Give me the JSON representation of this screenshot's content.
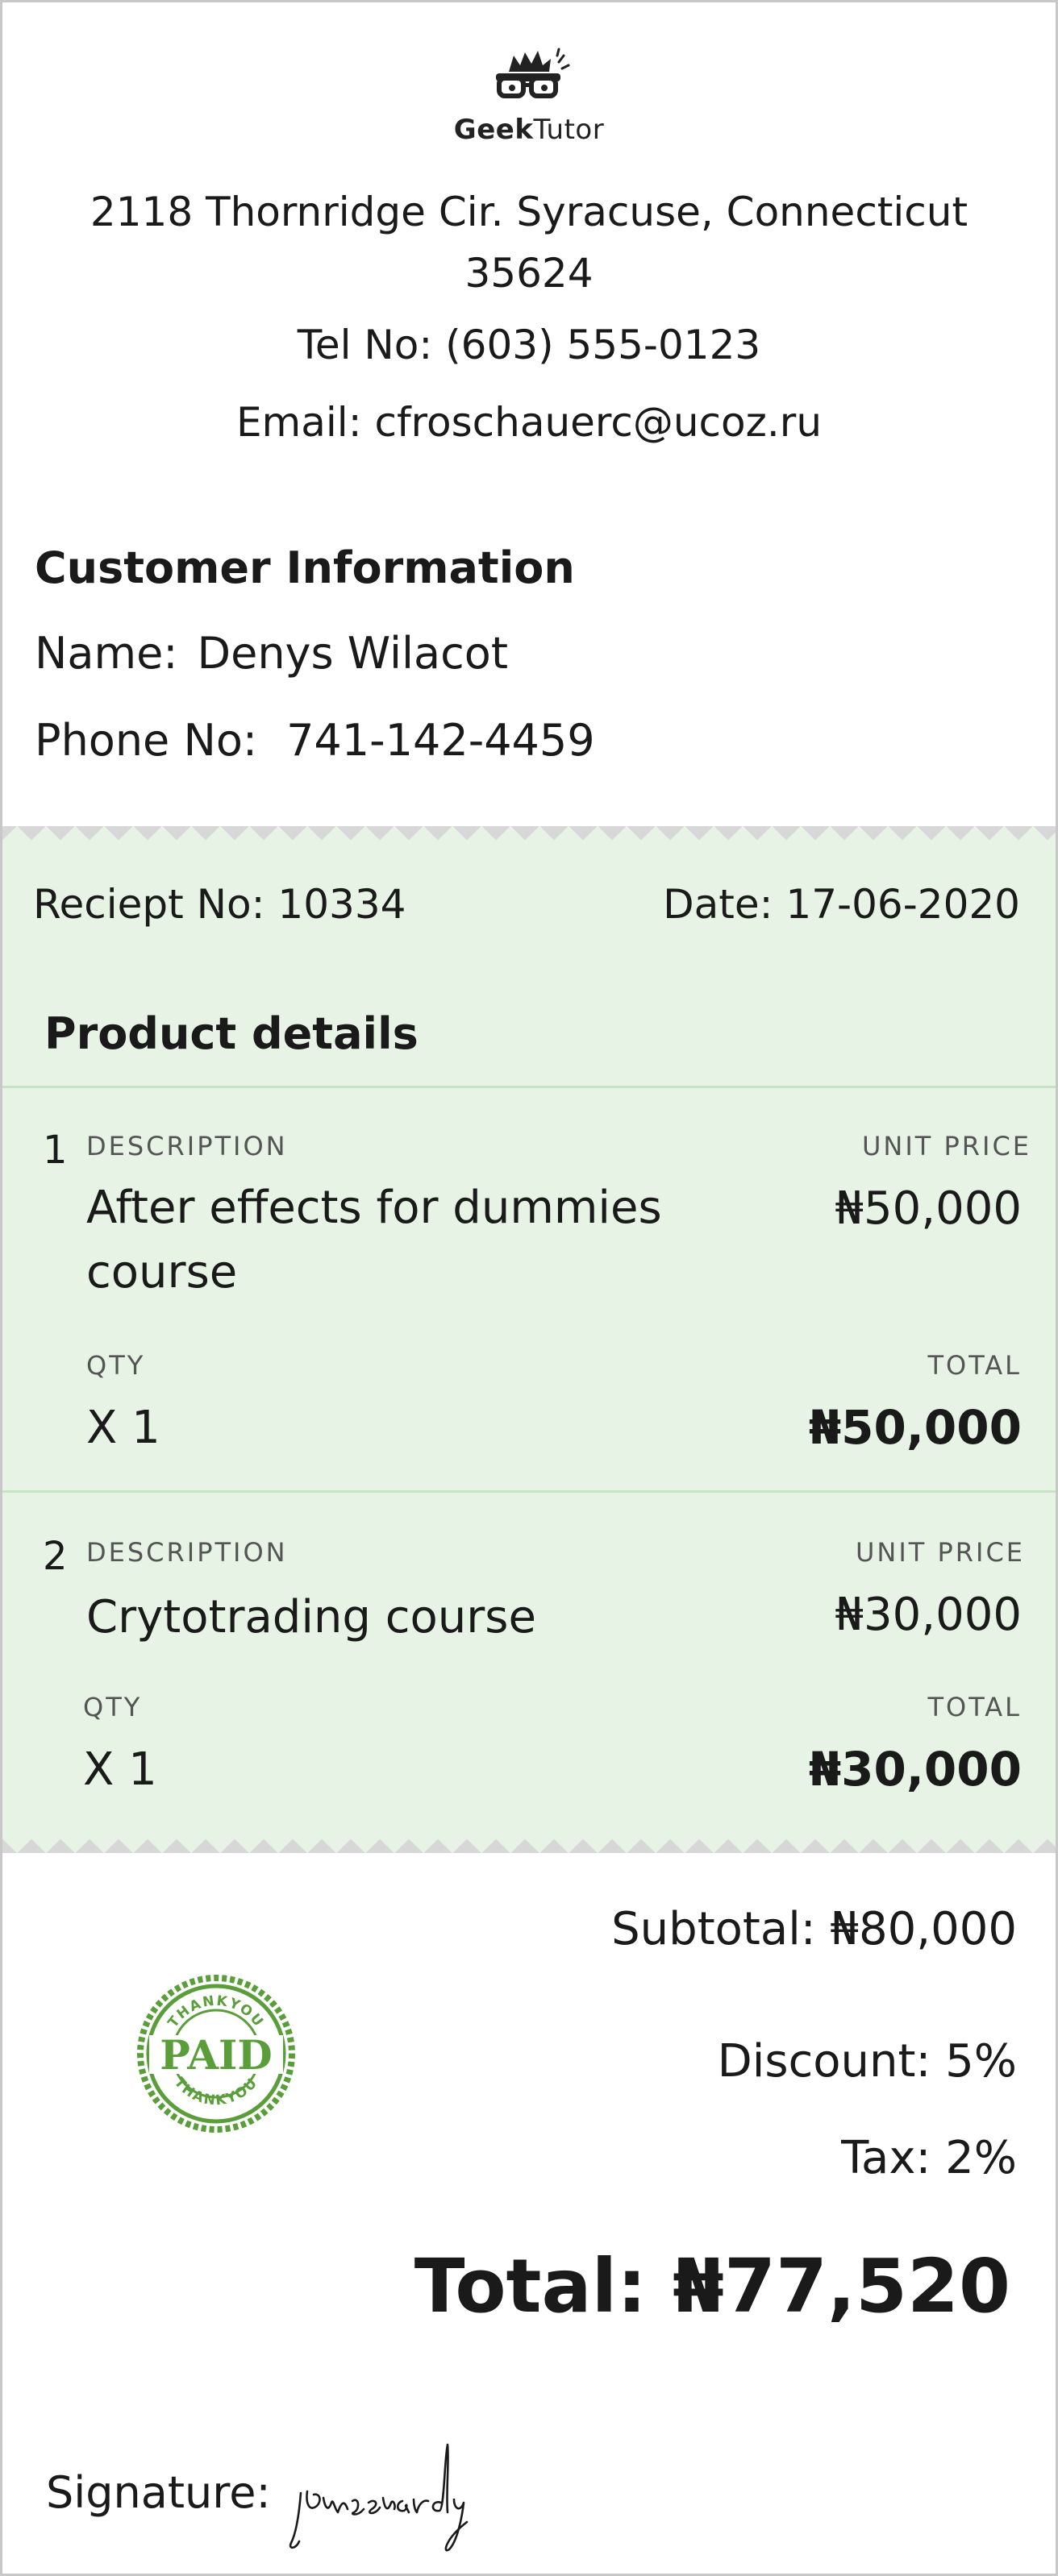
{
  "brand": {
    "name_bold": "Geek",
    "name_regular": "Tutor"
  },
  "header": {
    "address": "2118 Thornridge Cir. Syracuse, Connecticut 35624",
    "tel_label": "Tel No:",
    "tel_value": "(603) 555-0123",
    "email_label": "Email:",
    "email_value": "cfroschauerc@ucoz.ru"
  },
  "customer": {
    "title": "Customer Information",
    "name_label": "Name:",
    "name_value": "Denys Wilacot",
    "phone_label": "Phone No:",
    "phone_value": "741-142-4459"
  },
  "receipt": {
    "receipt_label": "Reciept No:",
    "receipt_no": "10334",
    "date_label": "Date:",
    "date_value": "17-06-2020"
  },
  "products": {
    "title": "Product details",
    "labels": {
      "description": "DESCRIPTION",
      "unit_price": "UNIT PRICE",
      "qty": "QTY",
      "total": "TOTAL"
    },
    "items": [
      {
        "num": "1",
        "description": "After effects for dummies course",
        "unit_price": "₦50,000",
        "qty": "X 1",
        "total": "₦50,000"
      },
      {
        "num": "2",
        "description": "Crytotrading course",
        "unit_price": "₦30,000",
        "qty": "X 1",
        "total": "₦30,000"
      }
    ]
  },
  "totals": {
    "subtotal": "Subtotal: ₦80,000",
    "discount": "Discount: 5%",
    "tax": "Tax: 2%",
    "total": "Total: ₦77,520"
  },
  "stamp": {
    "main": "PAID",
    "ring_top": "THANKYOU",
    "ring_bottom": "THANKYOU",
    "color": "#5a9e3a"
  },
  "signature": {
    "label": "Signature:",
    "text": "jamesvardy"
  },
  "colors": {
    "section_bg": "#e6f3e5",
    "zigzag": "#d7d7d7",
    "divider": "#c6e3c4"
  }
}
